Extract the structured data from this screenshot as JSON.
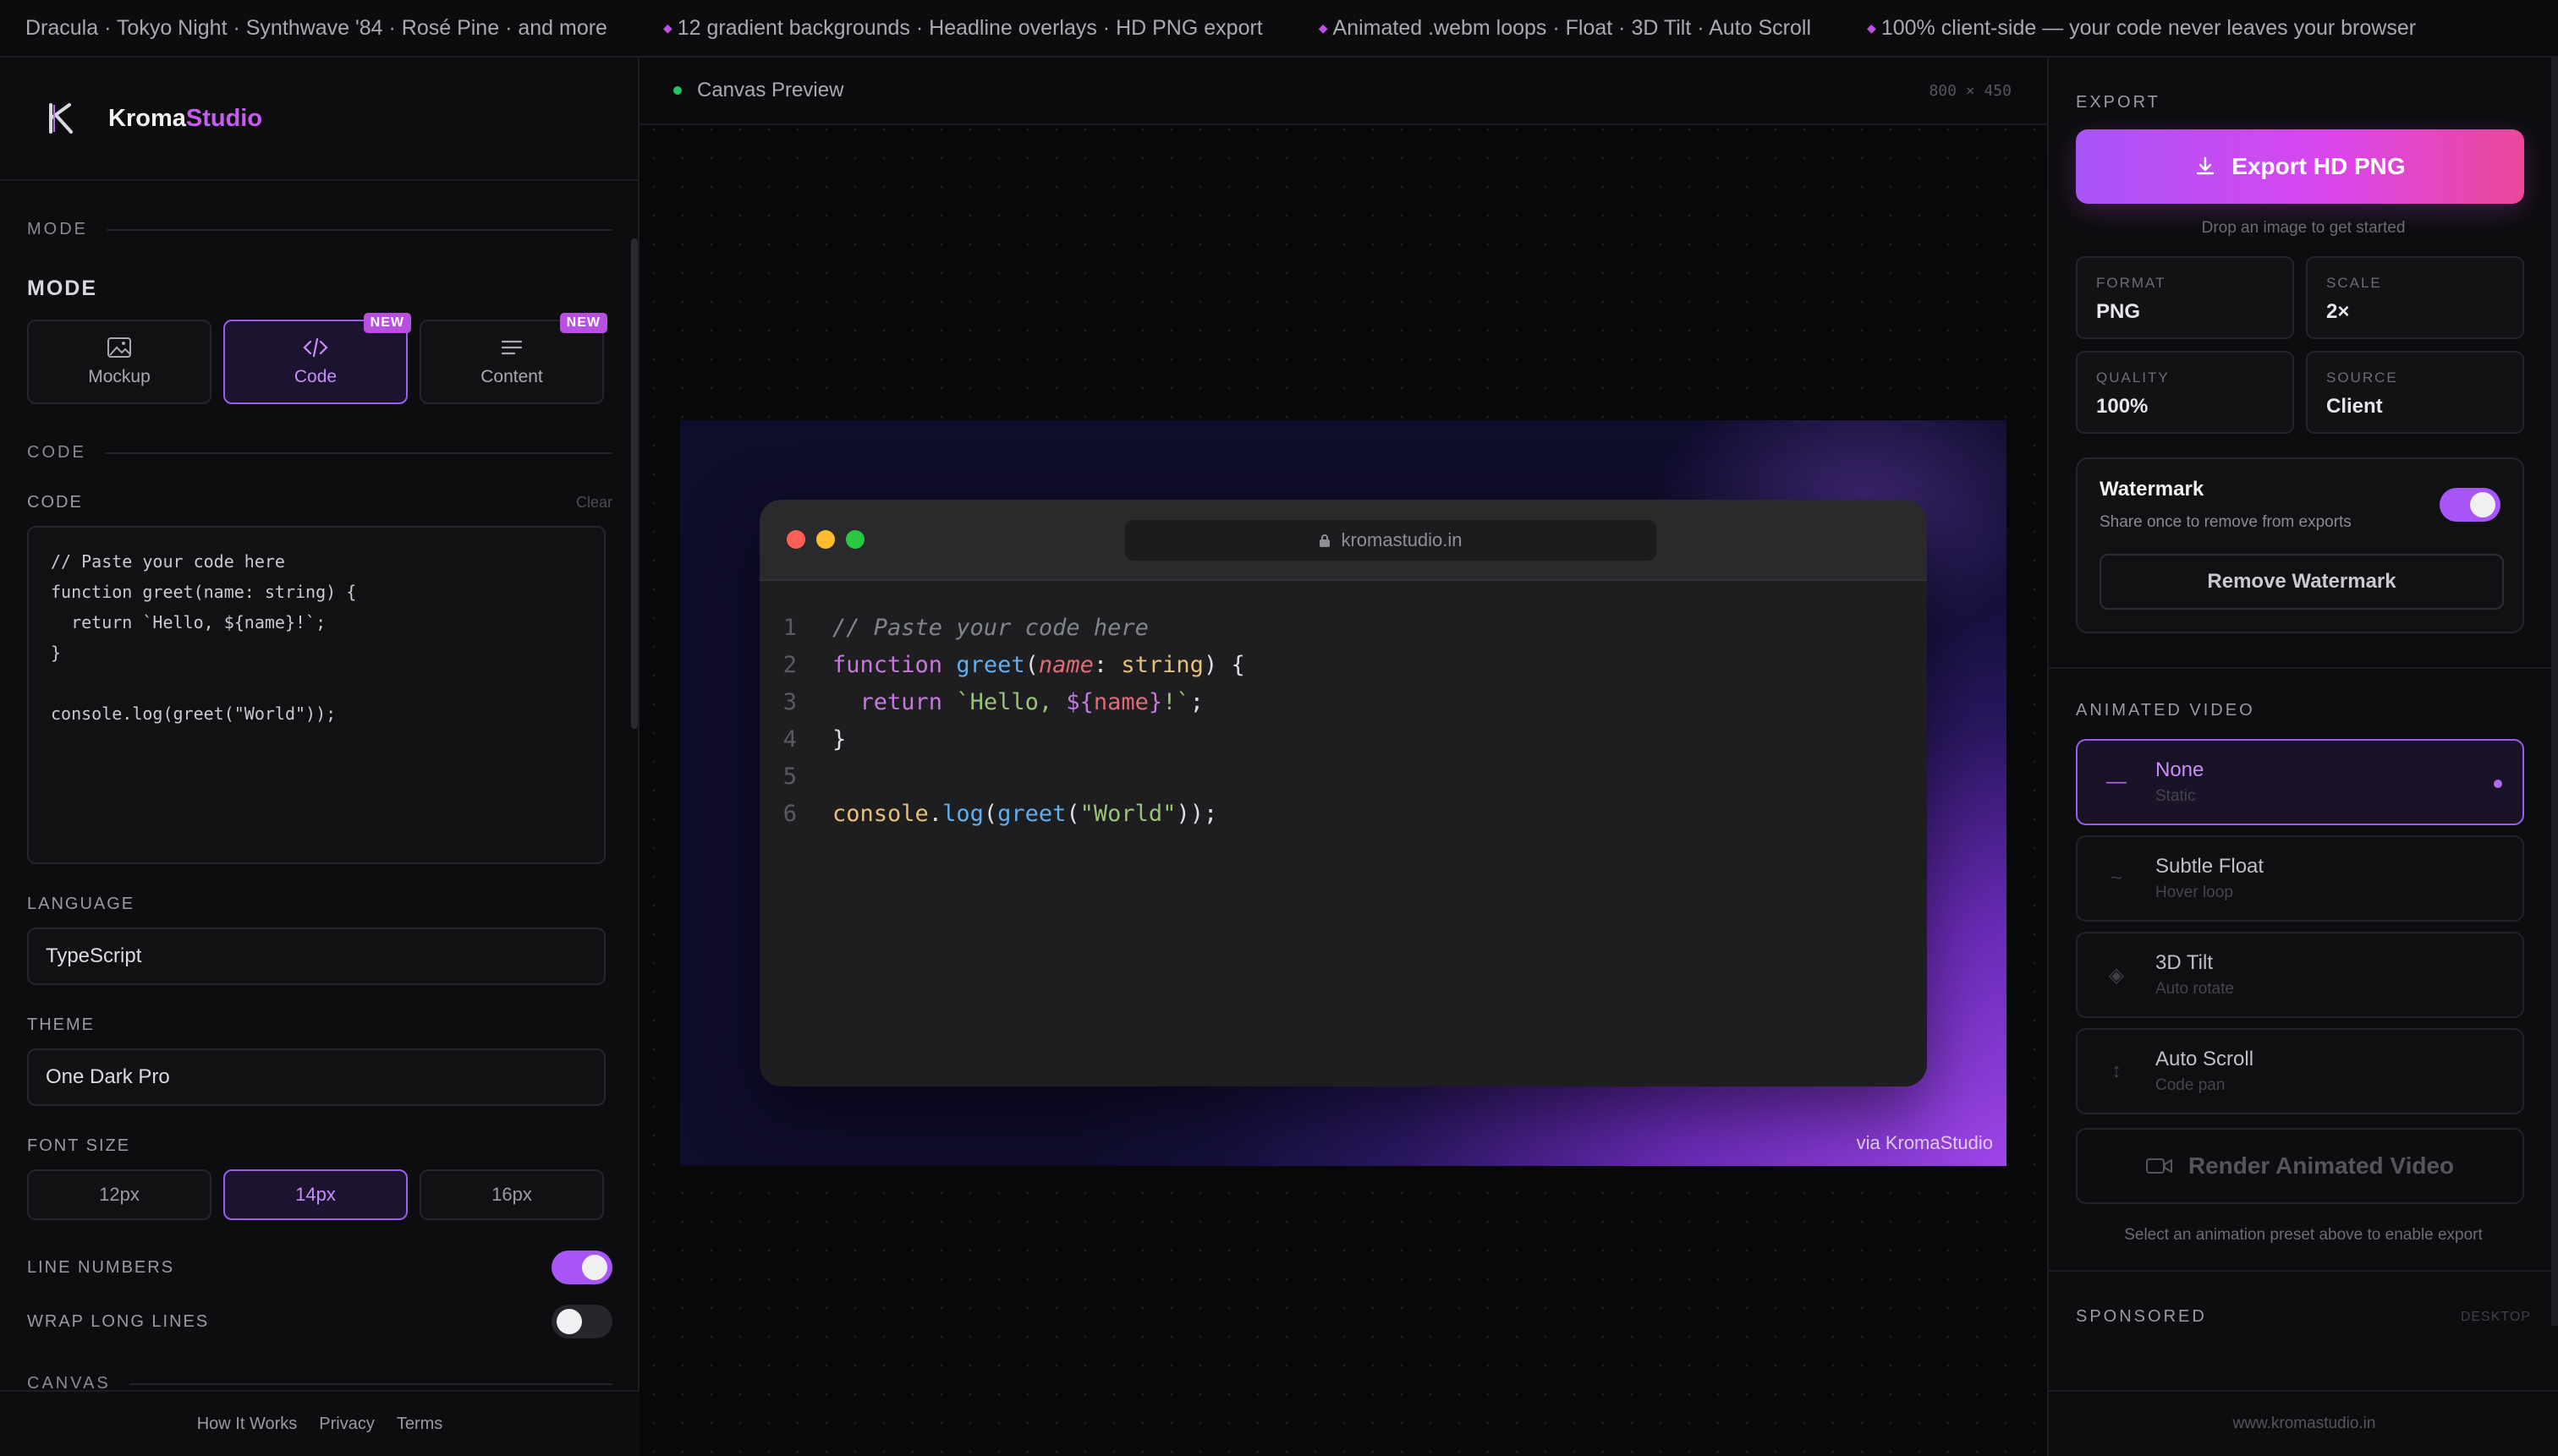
{
  "ticker": [
    "Dracula · Tokyo Night · Synthwave '84 · Rosé Pine · and more",
    "12 gradient backgrounds · Headline overlays · HD PNG export",
    "Animated .webm loops · Float · 3D Tilt · Auto Scroll",
    "100% client-side — your code never leaves your browser"
  ],
  "brand": {
    "name_part1": "Kroma",
    "name_part2": "Studio"
  },
  "sidebar": {
    "section_mode": "MODE",
    "mode_title": "MODE",
    "modes": [
      {
        "label": "Mockup",
        "icon": "image-icon",
        "badge": ""
      },
      {
        "label": "Code",
        "icon": "code-icon",
        "badge": "NEW"
      },
      {
        "label": "Content",
        "icon": "text-lines-icon",
        "badge": "NEW"
      }
    ],
    "section_code": "CODE",
    "code_label": "CODE",
    "clear_label": "Clear",
    "code_value": "// Paste your code here\nfunction greet(name: string) {\n  return `Hello, ${name}!`;\n}\n\nconsole.log(greet(\"World\"));",
    "language_label": "LANGUAGE",
    "language_value": "TypeScript",
    "theme_label": "THEME",
    "theme_value": "One Dark Pro",
    "font_size_label": "FONT SIZE",
    "font_sizes": [
      "12px",
      "14px",
      "16px"
    ],
    "line_numbers_label": "LINE NUMBERS",
    "line_numbers_on": true,
    "wrap_label": "WRAP LONG LINES",
    "wrap_on": false,
    "section_canvas": "CANVAS",
    "footer_links": [
      "How It Works",
      "Privacy",
      "Terms"
    ]
  },
  "preview": {
    "title": "Canvas Preview",
    "dims": "800 × 450",
    "url": "kromastudio.in",
    "line_numbers": [
      "1",
      "2",
      "3",
      "4",
      "5",
      "6"
    ],
    "watermark": "via KromaStudio",
    "colors": {
      "traffic_red": "#ff5f57",
      "traffic_yellow": "#febc2e",
      "traffic_green": "#28c840"
    }
  },
  "right": {
    "export_label": "EXPORT",
    "export_button": "Export HD PNG",
    "export_hint": "Drop an image to get started",
    "settings": [
      {
        "key": "FORMAT",
        "value": "PNG"
      },
      {
        "key": "SCALE",
        "value": "2×"
      },
      {
        "key": "QUALITY",
        "value": "100%"
      },
      {
        "key": "SOURCE",
        "value": "Client"
      }
    ],
    "watermark_title": "Watermark",
    "watermark_sub": "Share once to remove from exports",
    "watermark_on": true,
    "remove_watermark": "Remove Watermark",
    "animated_label": "ANIMATED VIDEO",
    "animations": [
      {
        "title": "None",
        "sub": "Static",
        "icon": "dash-icon",
        "glyph": "—"
      },
      {
        "title": "Subtle Float",
        "sub": "Hover loop",
        "icon": "wave-icon",
        "glyph": "~"
      },
      {
        "title": "3D Tilt",
        "sub": "Auto rotate",
        "icon": "diamond-icon",
        "glyph": "◈"
      },
      {
        "title": "Auto Scroll",
        "sub": "Code pan",
        "icon": "updown-icon",
        "glyph": "↕"
      }
    ],
    "render_button": "Render Animated Video",
    "render_hint": "Select an animation preset above to enable export",
    "sponsored_label": "SPONSORED",
    "sponsored_tag": "DESKTOP",
    "footer": "www.kromastudio.in"
  }
}
